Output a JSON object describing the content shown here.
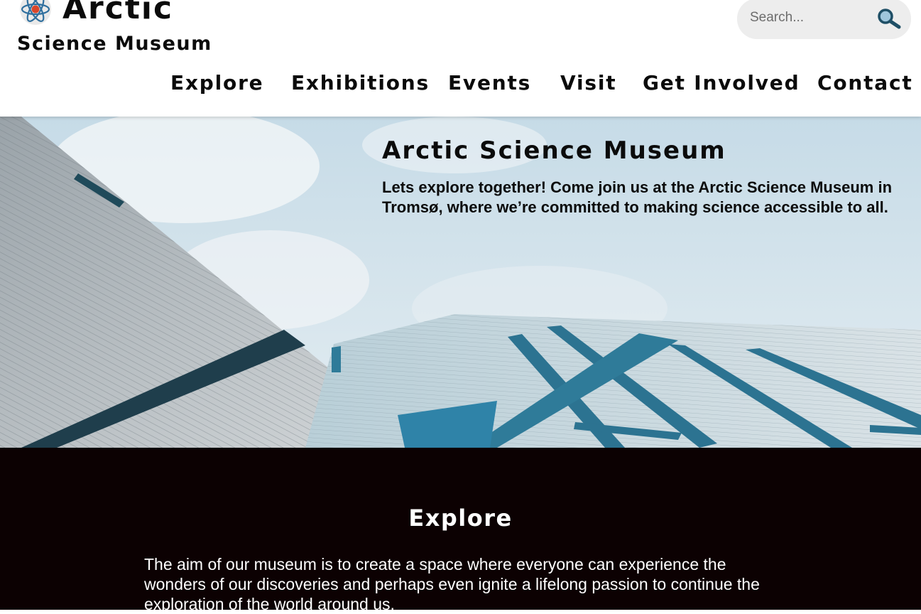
{
  "header": {
    "logo_title": "Arctic",
    "logo_subtitle": "Science Museum",
    "search": {
      "placeholder": "Search..."
    }
  },
  "nav": {
    "items": [
      "Explore",
      "Exhibitions",
      "Events",
      "Visit",
      "Get Involved",
      "Contact"
    ]
  },
  "hero": {
    "title": "Arctic Science Museum",
    "text": "Lets explore together! Come join us at the Arctic Science Museum in Tromsø, where we’re committed to making science accessible to all."
  },
  "explore": {
    "heading": "Explore",
    "text": "The aim of our museum is to create a space where everyone can experience the wonders of our discoveries and perhaps even ignite a lifelong passion to continue the exploration of the world around us."
  },
  "colors": {
    "dark_section": "#0c0102",
    "search_bg": "#ededed",
    "atom_blue": "#2f6f9e",
    "atom_red": "#d9472b"
  }
}
